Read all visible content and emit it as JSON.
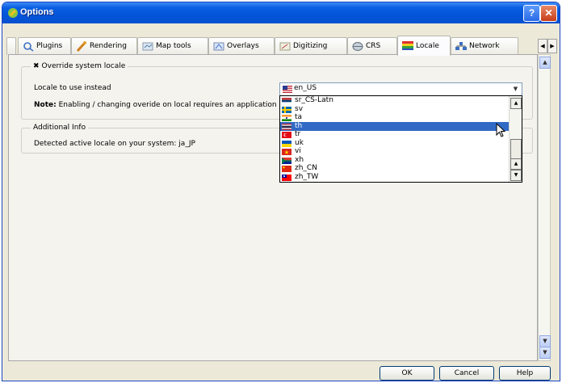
{
  "window": {
    "title": "Options",
    "help_glyph": "?",
    "close_glyph": "✕"
  },
  "tabs": [
    {
      "label": "Plugins",
      "icon": "plugins-icon"
    },
    {
      "label": "Rendering",
      "icon": "rendering-icon"
    },
    {
      "label": "Map tools",
      "icon": "map-tools-icon"
    },
    {
      "label": "Overlays",
      "icon": "overlays-icon"
    },
    {
      "label": "Digitizing",
      "icon": "digitizing-icon"
    },
    {
      "label": "CRS",
      "icon": "crs-icon"
    },
    {
      "label": "Locale",
      "icon": "locale-icon",
      "active": true
    },
    {
      "label": "Network",
      "icon": "network-icon"
    }
  ],
  "locale_group": {
    "title": "Override system locale",
    "checked": true,
    "check_glyph": "✖",
    "locale_label": "Locale to use instead",
    "note_bold": "Note:",
    "note_text": " Enabling / changing overide on local requires an application restart",
    "selected_locale": "en_US"
  },
  "locale_list": [
    {
      "code": "sr_CS-Latn",
      "flag": "serbia"
    },
    {
      "code": "sv",
      "flag": "sweden"
    },
    {
      "code": "ta",
      "flag": "india"
    },
    {
      "code": "th",
      "flag": "thailand",
      "selected": true
    },
    {
      "code": "tr",
      "flag": "turkey"
    },
    {
      "code": "uk",
      "flag": "ukraine"
    },
    {
      "code": "vi",
      "flag": "vietnam"
    },
    {
      "code": "xh",
      "flag": "south-africa"
    },
    {
      "code": "zh_CN",
      "flag": "china"
    },
    {
      "code": "zh_TW",
      "flag": "taiwan"
    }
  ],
  "info_group": {
    "title": "Additional Info",
    "detected_text": "Detected active locale on your system: ja_JP"
  },
  "buttons": {
    "ok": "OK",
    "cancel": "Cancel",
    "help": "Help"
  }
}
